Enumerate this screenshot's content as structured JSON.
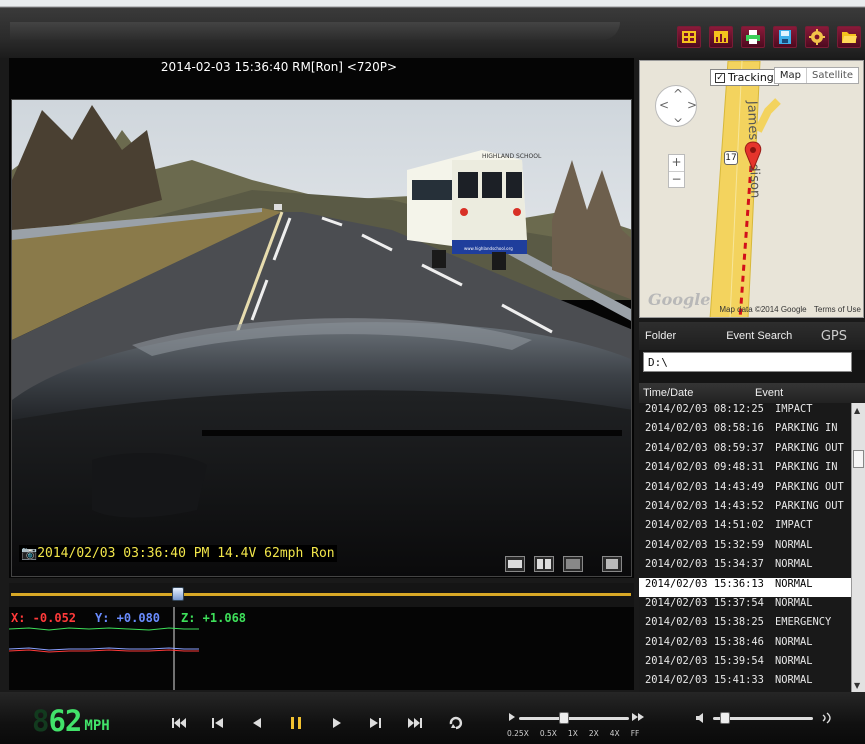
{
  "video": {
    "title": "2014-02-03 15:36:40 RM[Ron] <720P>",
    "overlay": "2014/02/03 03:36:40 PM 14.4V  62mph Ron",
    "bus_sign": "HIGHLAND SCHOOL",
    "bus_url": "www.highlandschool.org"
  },
  "toolbar": {
    "icons": [
      "video-split-icon",
      "chart-icon",
      "print-icon",
      "save-icon",
      "settings-gear-icon",
      "open-folder-icon"
    ]
  },
  "map": {
    "tracking_label": "Tracking",
    "tracking_checked": true,
    "map_btn": "Map",
    "satellite_btn": "Satellite",
    "road_label": "James Madison",
    "route_number": "17",
    "zoom_in": "+",
    "zoom_out": "−",
    "google": "Google",
    "map_data": "Map data ©2014 Google",
    "terms": "Terms of Use"
  },
  "panel": {
    "tab_folder": "Folder",
    "tab_event_search": "Event Search",
    "tab_gps": "GPS",
    "path": "D:\\",
    "col_time": "Time/Date",
    "col_event": "Event",
    "events": [
      {
        "date": "2014/02/03 08:12:25",
        "event": "IMPACT"
      },
      {
        "date": "2014/02/03 08:58:16",
        "event": "PARKING IN"
      },
      {
        "date": "2014/02/03 08:59:37",
        "event": "PARKING OUT"
      },
      {
        "date": "2014/02/03 09:48:31",
        "event": "PARKING IN"
      },
      {
        "date": "2014/02/03 14:43:49",
        "event": "PARKING OUT"
      },
      {
        "date": "2014/02/03 14:43:52",
        "event": "PARKING OUT"
      },
      {
        "date": "2014/02/03 14:51:02",
        "event": "IMPACT"
      },
      {
        "date": "2014/02/03 15:32:59",
        "event": "NORMAL"
      },
      {
        "date": "2014/02/03 15:34:37",
        "event": "NORMAL"
      },
      {
        "date": "2014/02/03 15:36:13",
        "event": "NORMAL"
      },
      {
        "date": "2014/02/03 15:37:54",
        "event": "NORMAL"
      },
      {
        "date": "2014/02/03 15:38:25",
        "event": "EMERGENCY"
      },
      {
        "date": "2014/02/03 15:38:46",
        "event": "NORMAL"
      },
      {
        "date": "2014/02/03 15:39:54",
        "event": "NORMAL"
      },
      {
        "date": "2014/02/03 15:41:33",
        "event": "NORMAL"
      }
    ],
    "selected_index": 9
  },
  "gsensor": {
    "x": "X: -0.052",
    "y": "Y: +0.080",
    "z": "Z: +1.068",
    "colors": {
      "x": "#ff3a3a",
      "y": "#6a8cff",
      "z": "#3ee05a"
    }
  },
  "playback": {
    "progress_fraction": 0.27,
    "speed_value": "62",
    "speed_unit": "MPH",
    "speed_marks": [
      "0.25X",
      "0.5X",
      "1X",
      "2X",
      "4X",
      "FF"
    ],
    "speed_selected": "1X",
    "volume_fraction": 0.12
  }
}
